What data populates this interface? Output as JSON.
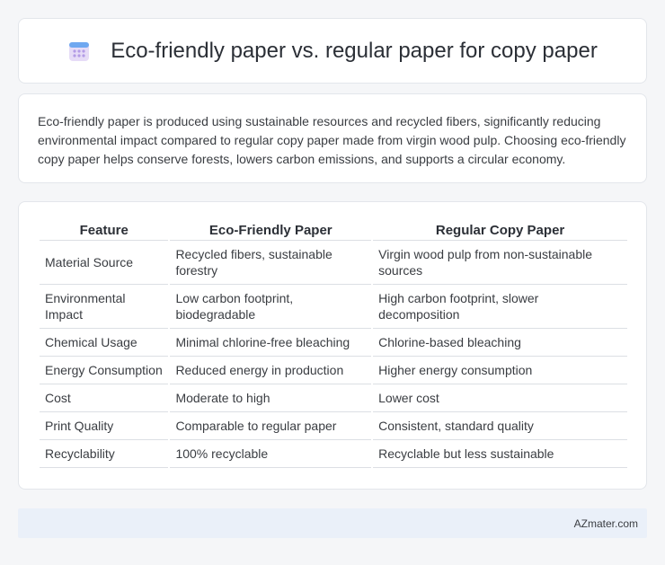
{
  "header": {
    "icon": "calendar-icon",
    "title": "Eco-friendly paper vs. regular paper for copy paper"
  },
  "intro": {
    "text": "Eco-friendly paper is produced using sustainable resources and recycled fibers, significantly reducing environmental impact compared to regular copy paper made from virgin wood pulp. Choosing eco-friendly copy paper helps conserve forests, lowers carbon emissions, and supports a circular economy."
  },
  "table": {
    "headers": [
      "Feature",
      "Eco-Friendly Paper",
      "Regular Copy Paper"
    ],
    "rows": [
      [
        "Material Source",
        "Recycled fibers, sustainable forestry",
        "Virgin wood pulp from non-sustainable sources"
      ],
      [
        "Environmental Impact",
        "Low carbon footprint, biodegradable",
        "High carbon footprint, slower decomposition"
      ],
      [
        "Chemical Usage",
        "Minimal chlorine-free bleaching",
        "Chlorine-based bleaching"
      ],
      [
        "Energy Consumption",
        "Reduced energy in production",
        "Higher energy consumption"
      ],
      [
        "Cost",
        "Moderate to high",
        "Lower cost"
      ],
      [
        "Print Quality",
        "Comparable to regular paper",
        "Consistent, standard quality"
      ],
      [
        "Recyclability",
        "100% recyclable",
        "Recyclable but less sustainable"
      ]
    ]
  },
  "footer": {
    "brand": "AZmater.com"
  }
}
